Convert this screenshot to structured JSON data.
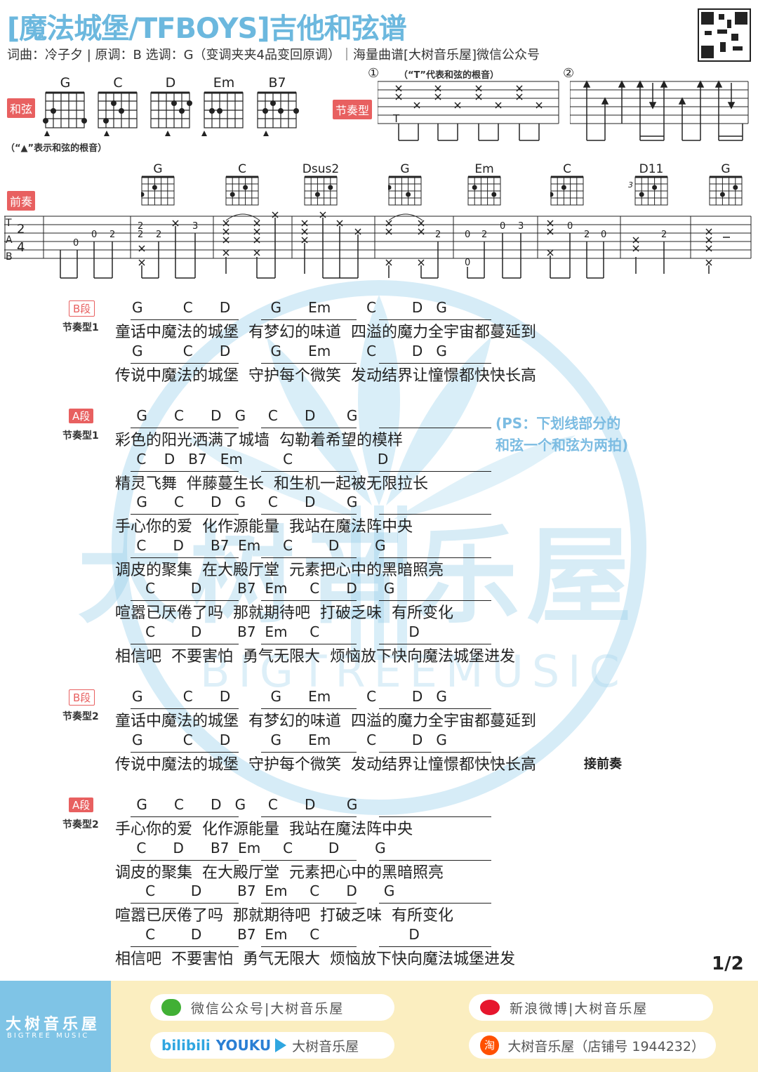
{
  "header": {
    "title": "[魔法城堡/TFBOYS]吉他和弦谱",
    "subtitle": "词曲：冷子夕 | 原调：B  选调：G（变调夹夹4品变回原调）｜海量曲谱[大树音乐屋]微信公众号"
  },
  "chords_section": {
    "label": "和弦",
    "chords": [
      "G",
      "C",
      "D",
      "Em",
      "B7"
    ],
    "note": "（“▲”表示和弦的根音）"
  },
  "rhythm_section": {
    "label": "节奏型",
    "pattern1_no": "①",
    "pattern1_note": "（“T”代表和弦的根音）",
    "pattern1_t": "T",
    "pattern2_no": "②"
  },
  "prelude": {
    "label": "前奏",
    "chords": [
      "G",
      "C",
      "Dsus2",
      "G",
      "Em",
      "C",
      "D11",
      "G"
    ],
    "fret3": "3",
    "tab_letters": [
      "T",
      "A",
      "B"
    ],
    "time_sig": [
      "2",
      "4"
    ]
  },
  "sections": [
    {
      "tag": "B段",
      "rhythm": "节奏型1",
      "lines": [
        {
          "chords": "G         C      D         G      Em        C        D   G",
          "lyric": "童话中魔法的城堡  有梦幻的味道  四溢的魔力全宇宙都蔓延到"
        },
        {
          "chords": "G         C      D         G      Em        C        D   G",
          "lyric": "传说中魔法的城堡  守护每个微笑  发动结界让憧憬都快快长高"
        }
      ]
    },
    {
      "tag": "A段",
      "rhythm": "节奏型1",
      "lines": [
        {
          "chords": " G      C      D   G     C      D       G",
          "lyric": "彩色的阳光洒满了城墙  勾勒着希望的模样"
        },
        {
          "chords": " C    D   B7   Em         C                   D",
          "lyric": "精灵飞舞  伴藤蔓生长  和生机一起被无限拉长"
        },
        {
          "chords": " G      C      D   G     C      D       G",
          "lyric": "手心你的爱  化作源能量  我站在魔法阵中央"
        },
        {
          "chords": " C      D      B7  Em     C        D        G",
          "lyric": "调皮的聚集  在大殿厅堂  元素把心中的黑暗照亮"
        },
        {
          "chords": "   C        D        B7  Em     C      D      G",
          "lyric": "喧嚣已厌倦了吗  那就期待吧  打破乏味  有所变化"
        },
        {
          "chords": "   C        D        B7  Em     C                    D",
          "lyric": "相信吧  不要害怕  勇气无限大  烦恼放下快向魔法城堡进发"
        }
      ]
    },
    {
      "tag": "B段",
      "rhythm": "节奏型2",
      "lines": [
        {
          "chords": "G         C      D         G      Em        C        D   G",
          "lyric": "童话中魔法的城堡  有梦幻的味道  四溢的魔力全宇宙都蔓延到"
        },
        {
          "chords": "G         C      D         G      Em        C        D   G",
          "lyric": "传说中魔法的城堡  守护每个微笑  发动结界让憧憬都快快长高"
        }
      ],
      "suffix": "接前奏"
    },
    {
      "tag": "A段",
      "rhythm": "节奏型2",
      "lines": [
        {
          "chords": " G      C      D   G     C      D       G",
          "lyric": "手心你的爱  化作源能量  我站在魔法阵中央"
        },
        {
          "chords": " C      D      B7  Em     C        D        G",
          "lyric": "调皮的聚集  在大殿厅堂  元素把心中的黑暗照亮"
        },
        {
          "chords": "   C        D        B7  Em     C      D      G",
          "lyric": "喧嚣已厌倦了吗  那就期待吧  打破乏味  有所变化"
        },
        {
          "chords": "   C        D        B7  Em     C                    D",
          "lyric": "相信吧  不要害怕  勇气无限大  烦恼放下快向魔法城堡进发"
        }
      ]
    }
  ],
  "ps_note": [
    "(PS：下划线部分的",
    "和弦一个和弦为两拍)"
  ],
  "watermark": [
    "大树音乐屋",
    "BIGTREEMUSIC"
  ],
  "page": "1/2",
  "footer": {
    "logo_cn": "大树音乐屋",
    "logo_en": "BIGTREE MUSIC",
    "wechat": "微信公众号|大树音乐屋",
    "weibo": "新浪微博|大树音乐屋",
    "video_bili": "bilibili",
    "video_youku": "YOUKU",
    "video_name": "大树音乐屋",
    "taobao": "大树音乐屋（店铺号 1944232）",
    "taobao_icon": "淘"
  },
  "colors": {
    "accent": "#6cb8de",
    "tag": "#e86060",
    "footer": "#fbeec0",
    "logo": "#7fc4e6"
  }
}
